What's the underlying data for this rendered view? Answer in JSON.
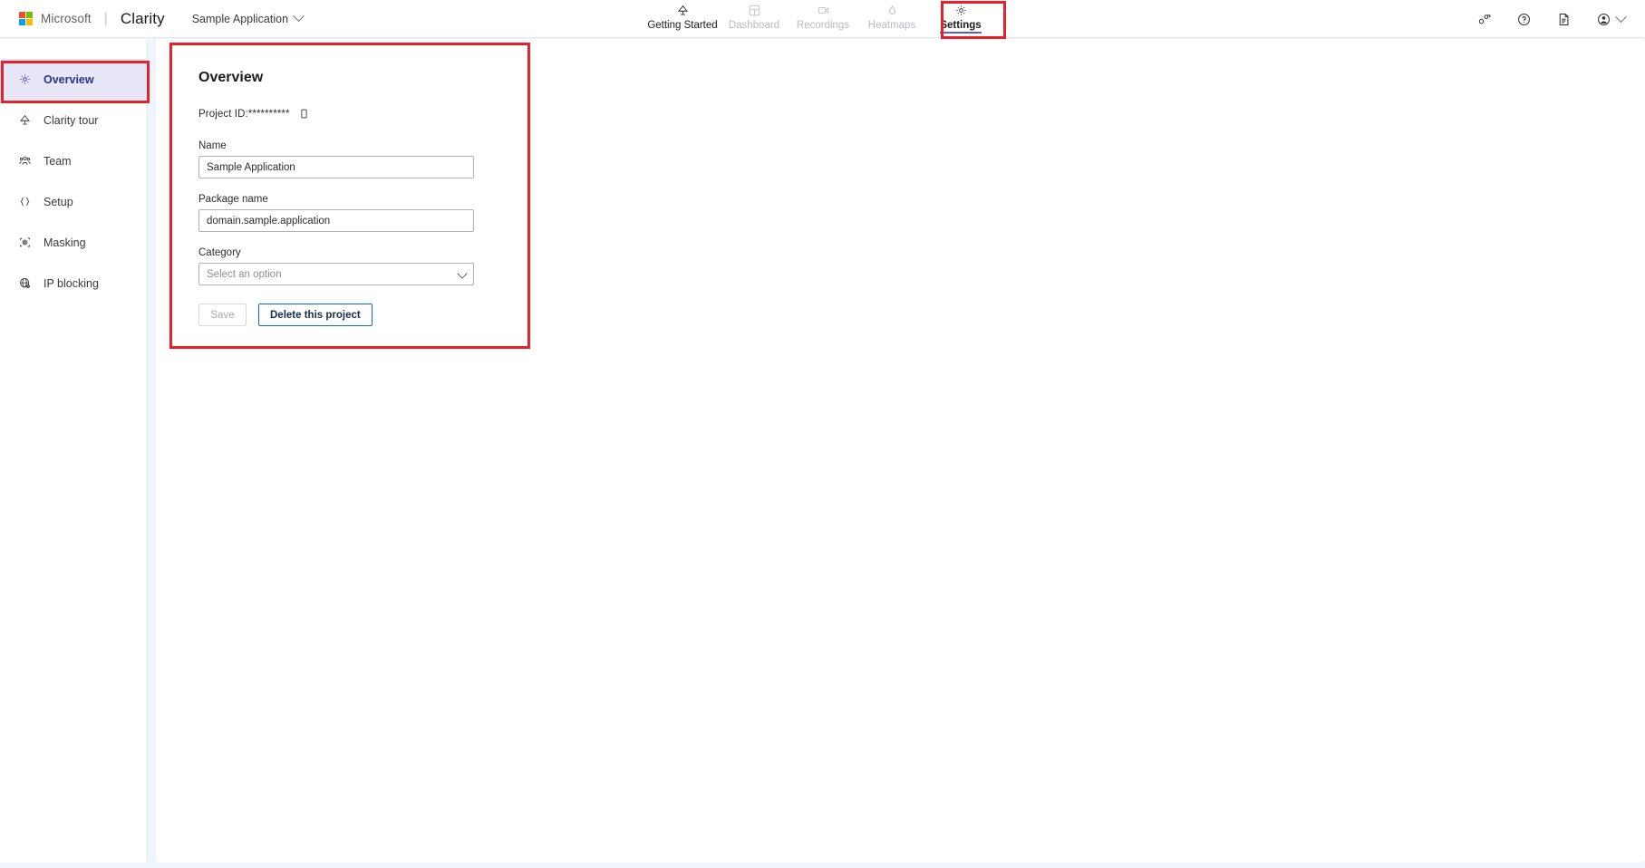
{
  "header": {
    "microsoft_label": "Microsoft",
    "separator": "|",
    "product_name": "Clarity",
    "project_selector": {
      "value": "Sample Application",
      "icon": "chevron-down-icon"
    },
    "nav": [
      {
        "label": "Getting Started",
        "icon": "lamp-icon",
        "state": "active"
      },
      {
        "label": "Dashboard",
        "icon": "dashboard-grid-icon",
        "state": "disabled"
      },
      {
        "label": "Recordings",
        "icon": "video-camera-icon",
        "state": "disabled"
      },
      {
        "label": "Heatmaps",
        "icon": "flame-icon",
        "state": "disabled"
      },
      {
        "label": "Settings",
        "icon": "gear-icon",
        "state": "current"
      }
    ],
    "right_icons": [
      {
        "name": "feedback-icon"
      },
      {
        "name": "help-question-icon"
      },
      {
        "name": "documentation-icon"
      },
      {
        "name": "account-avatar-icon"
      },
      {
        "name": "account-chevron-down-icon"
      }
    ]
  },
  "sidebar": {
    "items": [
      {
        "label": "Overview",
        "icon": "gear-icon",
        "selected": true
      },
      {
        "label": "Clarity tour",
        "icon": "lamp-icon",
        "selected": false
      },
      {
        "label": "Team",
        "icon": "people-icon",
        "selected": false
      },
      {
        "label": "Setup",
        "icon": "braces-code-icon",
        "selected": false
      },
      {
        "label": "Masking",
        "icon": "mask-icon",
        "selected": false
      },
      {
        "label": "IP blocking",
        "icon": "globe-block-icon",
        "selected": false
      }
    ]
  },
  "main": {
    "title": "Overview",
    "project_id": {
      "label": "Project ID:",
      "value": "**********",
      "copy_icon": "copy-icon"
    },
    "fields": {
      "name": {
        "label": "Name",
        "value": "Sample Application"
      },
      "package_name": {
        "label": "Package name",
        "value": "domain.sample.application"
      },
      "category": {
        "label": "Category",
        "value": "Select an option",
        "chevron_icon": "chevron-down-icon"
      }
    },
    "buttons": {
      "save": "Save",
      "delete": "Delete this project"
    }
  },
  "colors": {
    "page_background": "#eef5fc",
    "highlight_red": "#e8202a",
    "selected_nav_bg": "#e7e7f8",
    "selected_nav_text": "#2e2e8f",
    "accent_blue": "#1667c1",
    "tab_underline": "#5b5fc7"
  }
}
